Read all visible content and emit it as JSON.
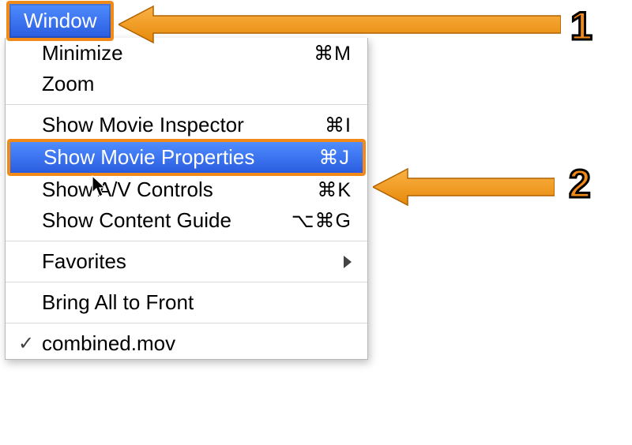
{
  "menubar": {
    "title": "Window"
  },
  "menu": {
    "items": [
      {
        "label": "Minimize",
        "shortcut": "⌘M"
      },
      {
        "label": "Zoom",
        "shortcut": ""
      },
      {
        "label": "Show Movie Inspector",
        "shortcut": "⌘I"
      },
      {
        "label": "Show Movie Properties",
        "shortcut": "⌘J"
      },
      {
        "label": "Show A/V Controls",
        "shortcut": "⌘K"
      },
      {
        "label": "Show Content Guide",
        "shortcut": "⌥⌘G"
      },
      {
        "label": "Favorites",
        "shortcut": ""
      },
      {
        "label": "Bring All to Front",
        "shortcut": ""
      },
      {
        "label": "combined.mov",
        "shortcut": ""
      }
    ]
  },
  "annotations": {
    "step1": "1",
    "step2": "2"
  }
}
